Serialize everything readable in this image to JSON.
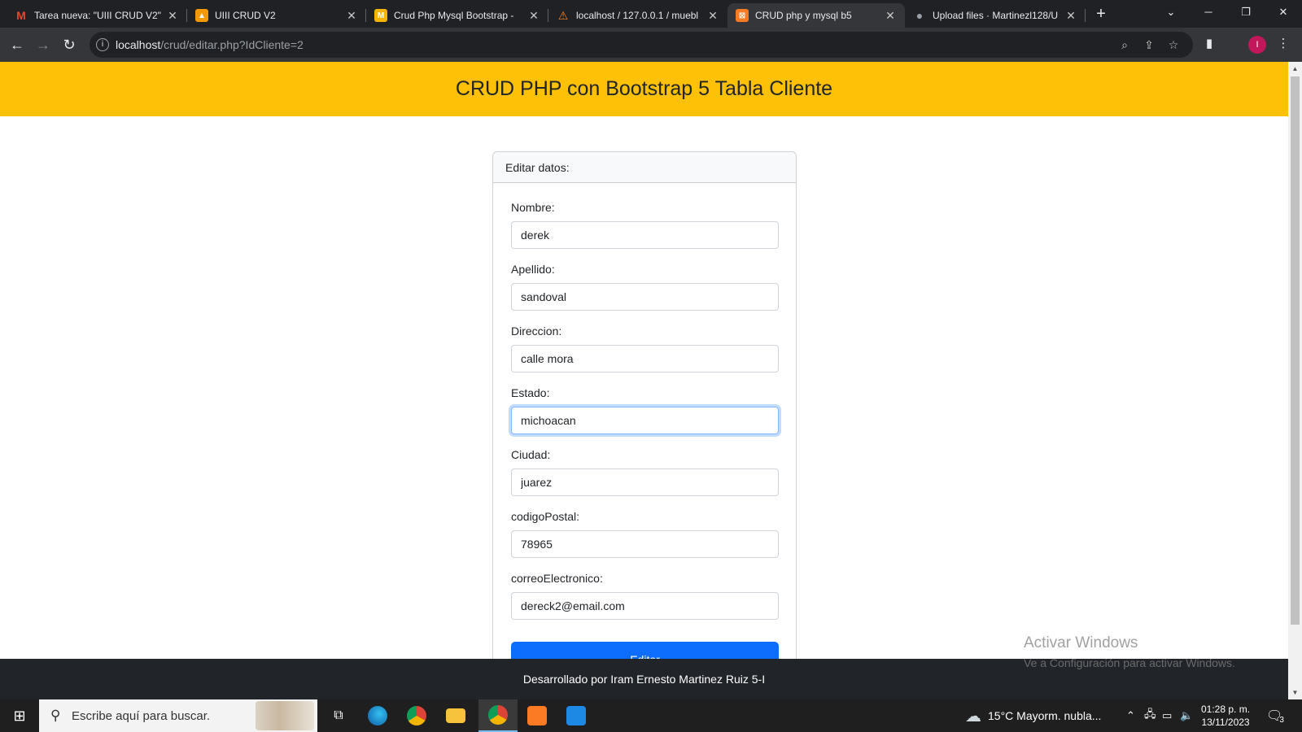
{
  "browser": {
    "tabs": [
      {
        "title": "Tarea nueva: \"UIII CRUD V2\"",
        "favicon": "gmail-icon",
        "favicon_color": "#ea4335",
        "favicon_glyph": "M"
      },
      {
        "title": "UIII CRUD V2",
        "favicon": "classroom-icon",
        "favicon_color": "#f29900",
        "favicon_glyph": "▲"
      },
      {
        "title": "Crud Php Mysql Bootstrap - ",
        "favicon": "blogger-icon",
        "favicon_color": "#f4b400",
        "favicon_glyph": "M"
      },
      {
        "title": "localhost / 127.0.0.1 / muebl",
        "favicon": "phpmyadmin-icon",
        "favicon_color": "#f58220",
        "favicon_glyph": "⚠"
      },
      {
        "title": "CRUD php y mysql b5",
        "favicon": "xampp-icon",
        "favicon_color": "#fb7a24",
        "favicon_glyph": "⊠"
      },
      {
        "title": "Upload files · Martinezl128/U",
        "favicon": "github-icon",
        "favicon_color": "#24292f",
        "favicon_glyph": "●"
      }
    ],
    "active_tab_index": 4,
    "new_tab_symbol": "+",
    "url_host": "localhost",
    "url_path": "/crud/editar.php?IdCliente=2",
    "profile_initial": "I"
  },
  "page": {
    "header_title": "CRUD PHP con Bootstrap 5 Tabla Cliente",
    "card_header": "Editar datos:",
    "fields": [
      {
        "label": "Nombre:",
        "value": "derek"
      },
      {
        "label": "Apellido:",
        "value": "sandoval"
      },
      {
        "label": "Direccion:",
        "value": "calle mora"
      },
      {
        "label": "Estado:",
        "value": "michoacan"
      },
      {
        "label": "Ciudad:",
        "value": "juarez"
      },
      {
        "label": "codigoPostal:",
        "value": "78965"
      },
      {
        "label": "correoElectronico:",
        "value": "dereck2@email.com"
      }
    ],
    "focused_field_index": 3,
    "submit_label": "Editar",
    "footer_text": "Desarrollado por Iram Ernesto Martinez Ruiz 5-I",
    "accent_color": "#ffc107",
    "button_color": "#0d6efd"
  },
  "watermark": {
    "line1": "Activar Windows",
    "line2": "Ve a Configuración para activar Windows."
  },
  "taskbar": {
    "search_placeholder": "Escribe aquí para buscar.",
    "weather": "15°C  Mayorm. nubla...",
    "time": "01:28 p. m.",
    "date": "13/11/2023",
    "notification_count": "3"
  }
}
